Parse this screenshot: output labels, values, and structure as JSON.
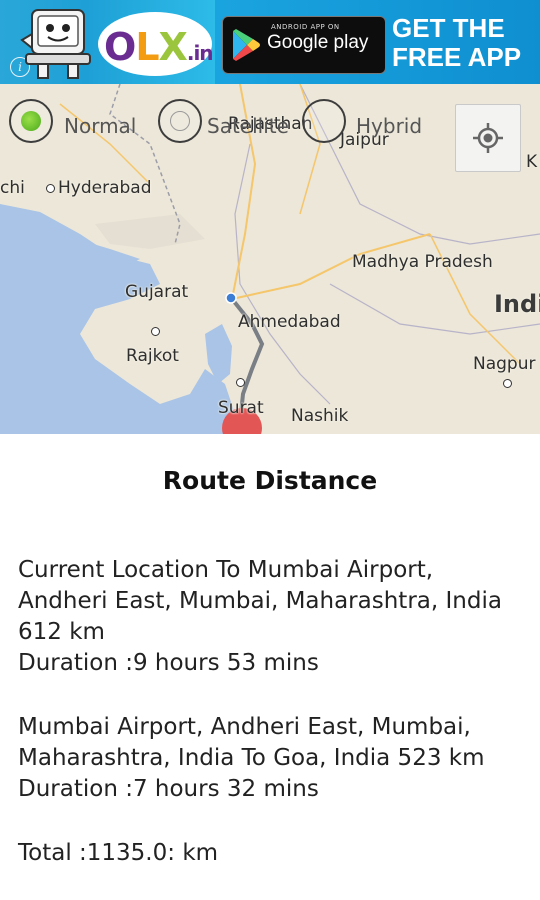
{
  "ad": {
    "brand_main": "OLX",
    "brand_o": "O",
    "brand_l": "L",
    "brand_x": "X",
    "brand_suffix": ".in",
    "store_small": "ANDROID APP ON",
    "store_big": "Google play",
    "cta_line1": "GET THE",
    "cta_line2": "FREE APP",
    "info_glyph": "i"
  },
  "map_type": {
    "selected": "Normal",
    "options": [
      {
        "label": "Normal"
      },
      {
        "label": "Satellite"
      },
      {
        "label": "Hybrid"
      }
    ]
  },
  "map": {
    "labels": {
      "karachi": "chi",
      "hyderabad": "Hyderabad",
      "rajasthan": "Rajasthan",
      "jaipur": "Jaipur",
      "gujarat": "Gujarat",
      "ahmedabad": "Ahmedabad",
      "rajkot": "Rajkot",
      "surat": "Surat",
      "nashik": "Nashik",
      "madhya_pradesh": "Madhya Pradesh",
      "india": "Indi",
      "nagpur": "Nagpur",
      "edge_k": "K"
    },
    "colors": {
      "sea": "#a9c4e6",
      "land": "#ece7d9",
      "route": "#7a7f86",
      "start_marker": "#3c7ed6",
      "end_marker": "#e35656"
    }
  },
  "route": {
    "title": "Route Distance",
    "leg1": {
      "line1": "Current Location To Mumbai Airport,",
      "line2": "Andheri East, Mumbai, Maharashtra, India",
      "line3": "612 km",
      "duration": "Duration :9 hours 53 mins"
    },
    "leg2": {
      "line1": "Mumbai Airport, Andheri East, Mumbai,",
      "line2": "Maharashtra, India To Goa, India 523 km",
      "duration": "Duration :7 hours 32 mins"
    },
    "total": "Total :1135.0: km"
  }
}
